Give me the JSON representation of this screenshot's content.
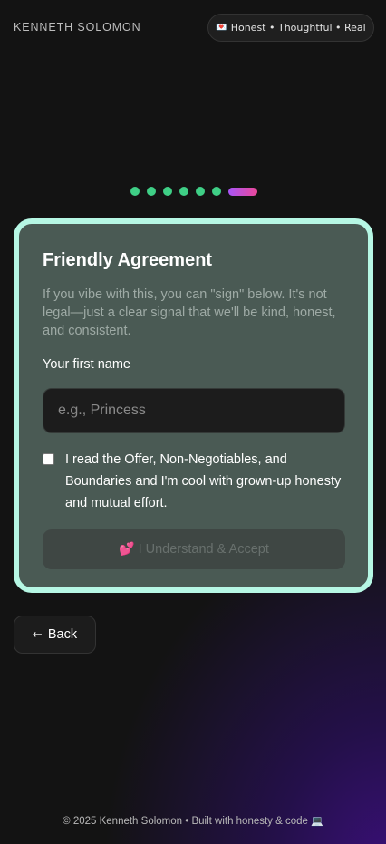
{
  "header": {
    "brand": "KENNETH SOLOMON",
    "tagline_icon": "💌",
    "tagline": "Honest • Thoughtful • Real"
  },
  "progress": {
    "total_steps": 7,
    "completed_steps": 6,
    "current_step": 7,
    "completed_color": "#3fcf86",
    "active_gradient": [
      "#a855f7",
      "#ec4899"
    ]
  },
  "agreement": {
    "title": "Friendly Agreement",
    "description": "If you vibe with this, you can \"sign\" below. It's not legal—just a clear signal that we'll be kind, honest, and consistent.",
    "name_label": "Your first name",
    "name_value": "",
    "name_placeholder": "e.g., Princess",
    "checkbox_checked": false,
    "checkbox_label": "I read the Offer, Non-Negotiables, and Boundaries and I'm cool with grown-up honesty and mutual effort.",
    "accept_icon": "💕",
    "accept_label": "I Understand & Accept",
    "accept_disabled": true
  },
  "nav": {
    "back_icon": "←",
    "back_label": "Back"
  },
  "footer": {
    "text": "© 2025 Kenneth Solomon • Built with honesty & code",
    "icon": "💻"
  },
  "colors": {
    "card_border": "#b6f7e4",
    "card_bg": "#4a5a54",
    "page_bg": "#131313",
    "accent_purple": "#3a0f78"
  }
}
